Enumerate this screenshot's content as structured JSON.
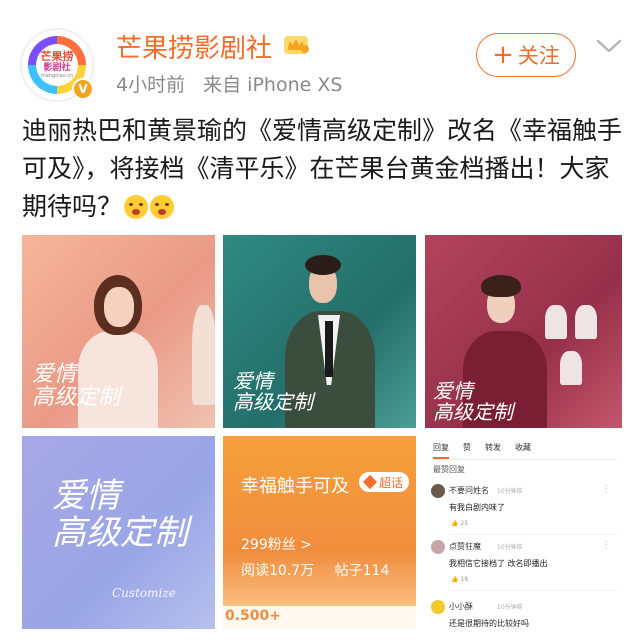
{
  "post": {
    "avatar": {
      "line1": "芒果捞",
      "line2": "影剧社",
      "line3": "mangolao.cn"
    },
    "verified_badge": "V",
    "username": "芒果捞影剧社",
    "time": "4小时前",
    "source": "来自 iPhone XS",
    "follow_button": "关注",
    "follow_plus": "+",
    "text": "迪丽热巴和黄景瑜的《爱情高级定制》改名《幸福触手可及》，将接档《清平乐》在芒果台黄金档播出！大家期待吗？",
    "emojis": [
      "face-emoji",
      "face-emoji"
    ]
  },
  "images": {
    "poster1_title": "爱情\n高级定制",
    "poster2_title": "爱情\n高级定制",
    "poster3_title": "爱情\n高级定制",
    "poster4_title": "爱情\n高级定制",
    "poster4_signature": "Customize",
    "weibo_card": {
      "title": "幸福触手可及",
      "badge": "超话",
      "fans": "299粉丝 >",
      "reads": "阅读10.7万",
      "posts": "帖子114",
      "bottom": "0.500+"
    },
    "comments_card": {
      "tabs": [
        "回复",
        "赞",
        "转发",
        "收藏"
      ],
      "section": "最赞回复",
      "comments": [
        {
          "name": "不要问姓名",
          "time": "10分钟前",
          "text": "有我白剧内味了",
          "likes": "25"
        },
        {
          "name": "点赞狂魔",
          "time": "10分钟前",
          "text": "我相信它接档了 改名即播出",
          "likes": "18"
        },
        {
          "name": "小小酥",
          "time": "10分钟前",
          "text": "还是很期待的比较好吗",
          "likes": ""
        }
      ]
    }
  },
  "colors": {
    "accent": "#f46b2a",
    "meta_gray": "#8a8a8a"
  },
  "icons": {
    "crown": "crown-icon",
    "chevron": "chevron-down-icon",
    "gem": "gem-icon"
  }
}
